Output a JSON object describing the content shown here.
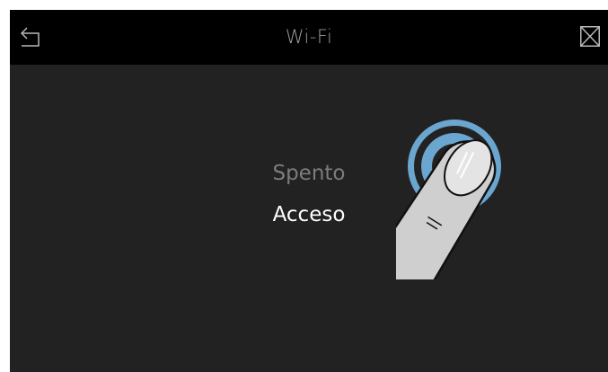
{
  "header": {
    "title": "Wi-Fi",
    "back_icon": "back-arrow-icon",
    "close_icon": "close-icon"
  },
  "options": [
    {
      "label": "Spento",
      "selected": false
    },
    {
      "label": "Acceso",
      "selected": true
    }
  ],
  "gesture": {
    "icon": "tap-finger-icon",
    "ripple_color": "#6aa6cf"
  },
  "colors": {
    "header_bg": "#000000",
    "screen_bg": "#222222",
    "title": "#9a9a9a",
    "option_inactive": "#7c7c7c",
    "option_active": "#ffffff"
  }
}
